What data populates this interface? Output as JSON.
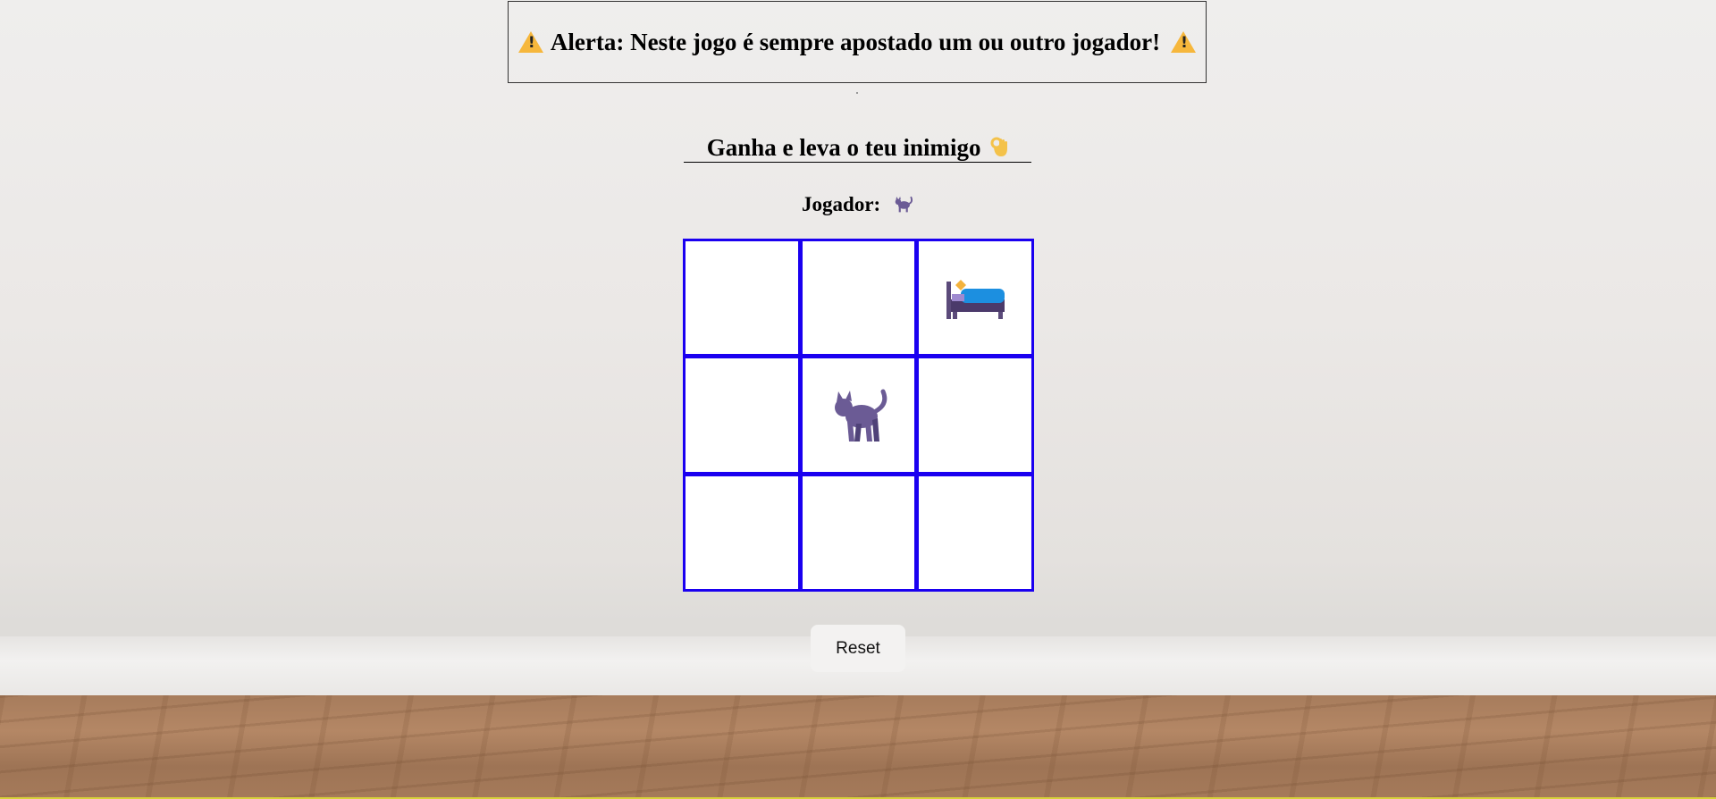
{
  "alert": {
    "text": "Alerta: Neste jogo é sempre apostado um ou outro jogador!",
    "icon_left": "warning-icon",
    "icon_right": "warning-icon"
  },
  "title": {
    "text": "Ganha e leva o teu inimigo",
    "icon": "ok-hand-icon"
  },
  "player": {
    "label": "Jogador:",
    "current_icon": "cat-icon"
  },
  "board": {
    "cells": [
      "",
      "",
      "bed-icon",
      "",
      "cat-icon",
      "",
      "",
      "",
      ""
    ]
  },
  "reset_button": {
    "label": "Reset"
  },
  "colors": {
    "board_lines": "#1a00f0",
    "cell_bg": "#ffffff",
    "warning": "#f6b73c",
    "cat": "#6b5b95"
  }
}
